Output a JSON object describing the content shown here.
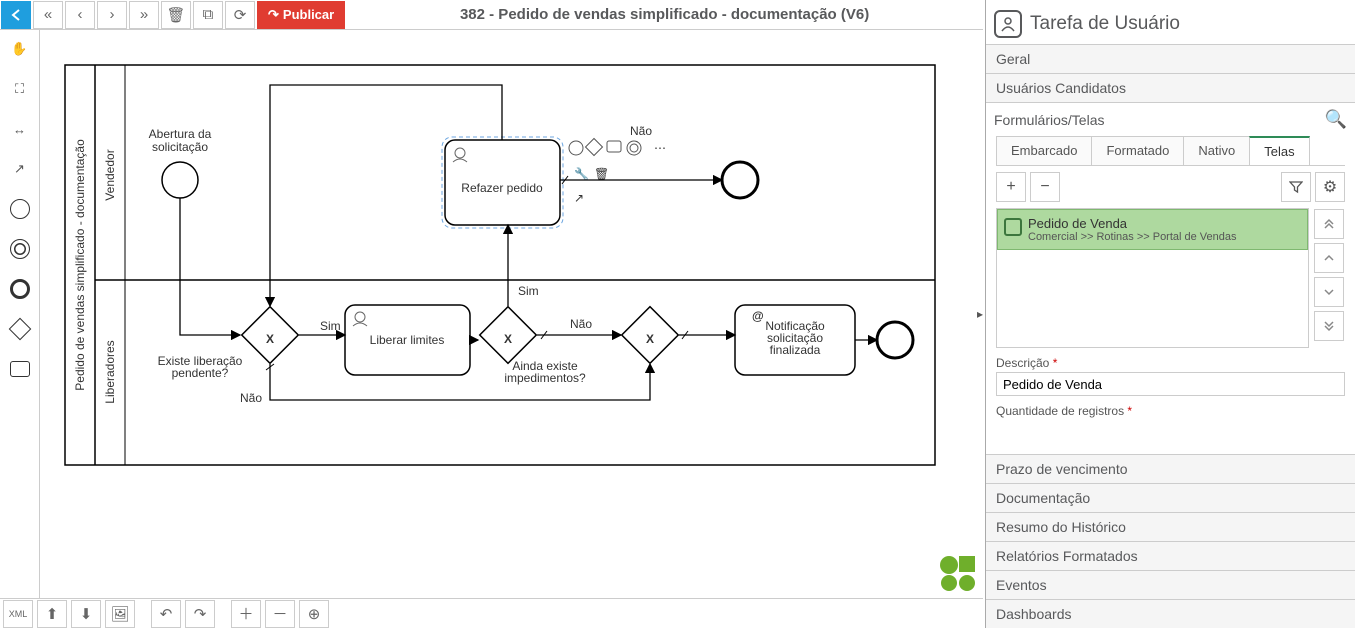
{
  "header": {
    "title": "382 - Pedido de vendas simplificado - documentação (V6)",
    "publish": "Publicar"
  },
  "pool_label": "Pedido de vendas simplificado - documentação",
  "lanes": {
    "top": "Vendedor",
    "bottom": "Liberadores"
  },
  "nodes": {
    "start_label": "Abertura da solicitação",
    "gw1_label": "Existe liberação pendente?",
    "task_liberar": "Liberar limites",
    "gw2_label": "Ainda existe impedimentos?",
    "task_refazer": "Refazer pedido",
    "task_notif": "Notificação solicitação finalizada"
  },
  "edges": {
    "sim": "Sim",
    "nao": "Não"
  },
  "panel": {
    "title": "Tarefa de Usuário",
    "acc": {
      "geral": "Geral",
      "usuarios": "Usuários Candidatos",
      "form": "Formulários/Telas",
      "prazo": "Prazo de vencimento",
      "doc": "Documentação",
      "resumo": "Resumo do Histórico",
      "rel": "Relatórios Formatados",
      "ev": "Eventos",
      "dash": "Dashboards"
    },
    "tabs": {
      "embarcado": "Embarcado",
      "formatado": "Formatado",
      "nativo": "Nativo",
      "telas": "Telas"
    },
    "item": {
      "title": "Pedido de Venda",
      "path": "Comercial >> Rotinas >> Portal de Vendas"
    },
    "fields": {
      "descricao": "Descrição",
      "descricao_val": "Pedido de Venda",
      "qtd": "Quantidade de registros"
    }
  }
}
